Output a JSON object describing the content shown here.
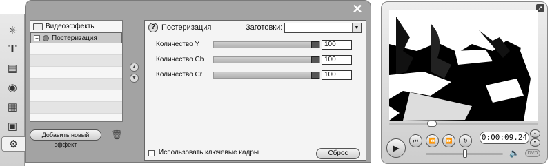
{
  "effects_list": {
    "category_label": "Видеоэффекты",
    "selected_item_label": "Постеризация",
    "add_button_label": "Добавить новый эффект"
  },
  "settings": {
    "title": "Постеризация",
    "presets_label": "Заготовки:",
    "presets_value": "",
    "params": [
      {
        "label": "Количество Y",
        "value": "100",
        "level": 1.0
      },
      {
        "label": "Количество Cb",
        "value": "100",
        "level": 1.0
      },
      {
        "label": "Количество Cr",
        "value": "100",
        "level": 1.0
      }
    ],
    "keyframes_label": "Использовать ключевые кадры",
    "reset_label": "Сброс"
  },
  "player": {
    "timecode": "0:00:09.24",
    "dvd_label": "DVD"
  },
  "icons": {
    "close": "close-icon",
    "help": "help-icon",
    "trash": "trash-icon",
    "play": "play-icon",
    "speaker": "speaker-icon"
  }
}
